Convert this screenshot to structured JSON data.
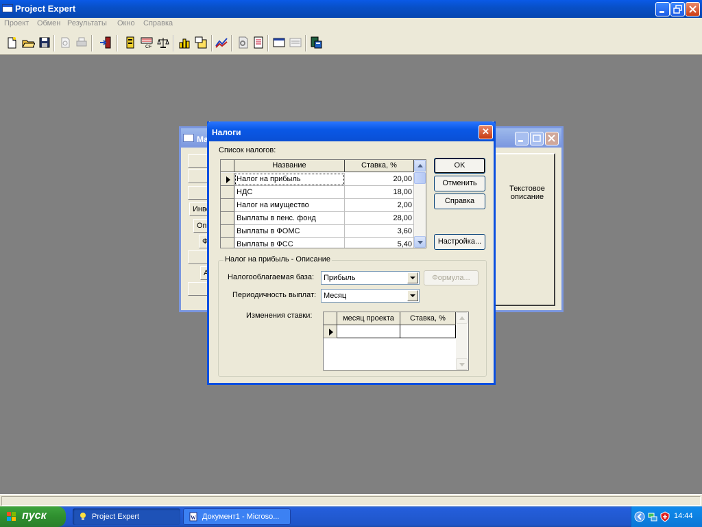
{
  "app": {
    "title": "Project Expert",
    "menu": [
      "Проект",
      "Обмен",
      "Результаты",
      "Окно",
      "Справка"
    ]
  },
  "background_window": {
    "title": "Ма",
    "tabs": [
      "Инве",
      "Опе",
      "Ф",
      "А"
    ],
    "description": "Текстовое описание"
  },
  "dialog": {
    "title": "Налоги",
    "close_glyph": "✕",
    "taxes_list_label": "Список налогов:",
    "columns": {
      "name": "Название",
      "rate": "Ставка, %"
    },
    "taxes": [
      {
        "name": "Налог на прибыль",
        "rate": "20,00",
        "current": true
      },
      {
        "name": "НДС",
        "rate": "18,00"
      },
      {
        "name": "Налог на имущество",
        "rate": "2,00"
      },
      {
        "name": "Выплаты в пенс. фонд",
        "rate": "28,00"
      },
      {
        "name": "Выплаты в ФОМС",
        "rate": "3,60"
      },
      {
        "name": "Выплаты в ФСС",
        "rate": "5,40"
      }
    ],
    "buttons": {
      "ok": "OK",
      "cancel": "Отменить",
      "help": "Справка",
      "settings": "Настройка...",
      "formula": "Формула..."
    },
    "description_group": {
      "title": "Налог на прибыль - Описание",
      "tax_base_label": "Налогооблагаемая база:",
      "tax_base_value": "Прибыль",
      "period_label": "Периодичность выплат:",
      "period_value": "Месяц",
      "rate_changes_label": "Изменения ставки:",
      "rate_changes_columns": {
        "month": "месяц проекта",
        "rate": "Ставка, %"
      }
    }
  },
  "taskbar": {
    "start_label": "пуск",
    "tasks": [
      {
        "label": "Project Expert",
        "active": true
      },
      {
        "label": "Документ1 - Microso...",
        "active": false
      }
    ],
    "clock": "14:44"
  },
  "colors": {
    "titlebar_blue": "#0a58e6",
    "dialog_face": "#ece9d8",
    "workspace": "#808080",
    "start_green": "#2f8f2f"
  }
}
